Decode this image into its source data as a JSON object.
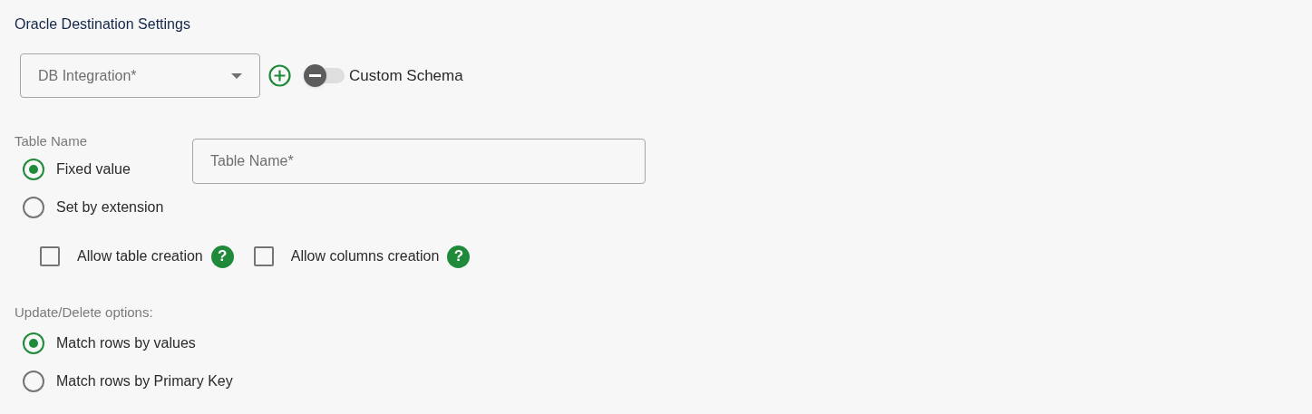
{
  "title": "Oracle Destination Settings",
  "integration_select": {
    "placeholder": "DB Integration*"
  },
  "custom_schema": {
    "label": "Custom Schema",
    "on": false
  },
  "table_name": {
    "label": "Table Name",
    "options": [
      {
        "label": "Fixed value",
        "selected": true
      },
      {
        "label": "Set by extension",
        "selected": false
      }
    ],
    "field": {
      "placeholder": "Table Name*"
    }
  },
  "checkboxes": [
    {
      "label": "Allow table creation",
      "checked": false,
      "help": "?"
    },
    {
      "label": "Allow columns creation",
      "checked": false,
      "help": "?"
    }
  ],
  "update_delete": {
    "label": "Update/Delete options:",
    "options": [
      {
        "label": "Match rows by values",
        "selected": true
      },
      {
        "label": "Match rows by Primary Key",
        "selected": false
      }
    ]
  }
}
